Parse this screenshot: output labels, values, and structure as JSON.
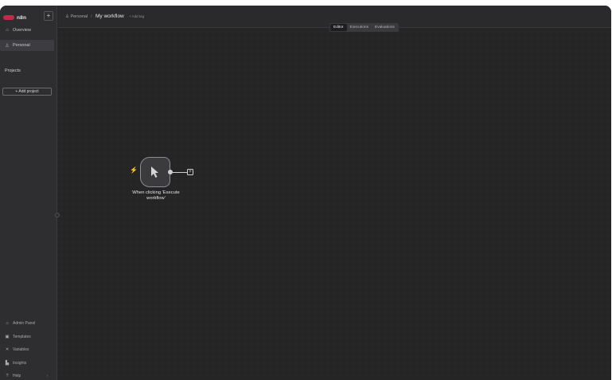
{
  "brand": {
    "name": "n8n",
    "color": "#c2294a"
  },
  "sidebar": {
    "new_button": "+",
    "nav": [
      {
        "icon": "home-icon",
        "glyph": "⌂",
        "label": "Overview"
      },
      {
        "icon": "user-icon",
        "glyph": "♙",
        "label": "Personal"
      }
    ],
    "projects_label": "Projects",
    "add_project": "+  Add project",
    "bottom": [
      {
        "icon": "admin-icon",
        "glyph": "⌂",
        "label": "Admin Panel"
      },
      {
        "icon": "templates-icon",
        "glyph": "▣",
        "label": "Templates"
      },
      {
        "icon": "variables-icon",
        "glyph": "✕",
        "label": "Variables"
      },
      {
        "icon": "insights-icon",
        "glyph": "▙",
        "label": "Insights"
      },
      {
        "icon": "help-icon",
        "glyph": "?",
        "label": "Help",
        "chevron": "›"
      }
    ]
  },
  "header": {
    "project": "♙ Personal",
    "separator": "/",
    "workflow_name": "My workflow",
    "add_tag": "+ Add tag"
  },
  "tabs": [
    "Editor",
    "Executions",
    "Evaluations"
  ],
  "active_tab": "Editor",
  "canvas": {
    "trigger_node": {
      "label": "When clicking 'Execute workflow'",
      "icon": "cursor-pointer-icon",
      "trigger_icon": "lightning-bolt-icon",
      "trigger_color": "#e0394f"
    },
    "add_node_glyph": "+"
  }
}
